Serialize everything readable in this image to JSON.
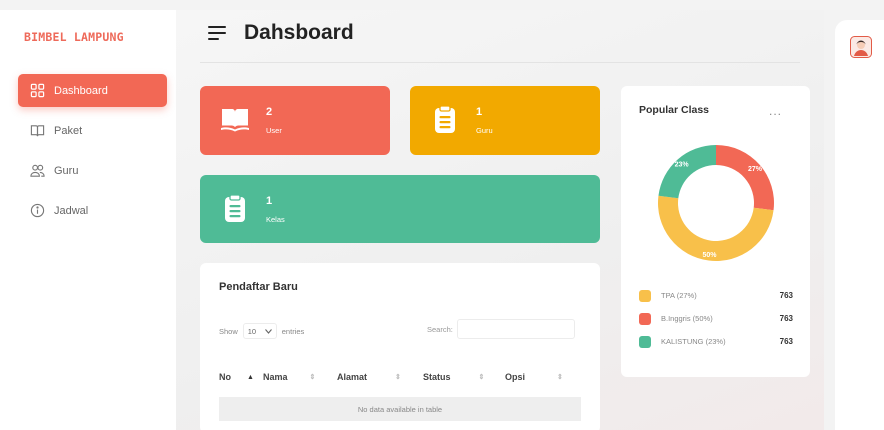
{
  "brand": "BIMBEL LAMPUNG",
  "sidebar": {
    "items": [
      {
        "label": "Dashboard",
        "icon": "grid-icon"
      },
      {
        "label": "Paket",
        "icon": "book-icon"
      },
      {
        "label": "Guru",
        "icon": "users-icon"
      },
      {
        "label": "Jadwal",
        "icon": "info-icon"
      }
    ]
  },
  "header": {
    "title": "Dahsboard"
  },
  "cards": {
    "user": {
      "value": "2",
      "label": "User",
      "color": "#f26855"
    },
    "guru": {
      "value": "1",
      "label": "Guru",
      "color": "#f2a900"
    },
    "kelas": {
      "value": "1",
      "label": "Kelas",
      "color": "#4fbb96"
    }
  },
  "table": {
    "title": "Pendaftar Baru",
    "show_label": "Show",
    "entries_value": "10",
    "entries_label": "entries",
    "search_label": "Search:",
    "search_value": "",
    "columns": [
      "No",
      "Nama",
      "Alamat",
      "Status",
      "Opsi"
    ],
    "empty_text": "No data available in table"
  },
  "popular": {
    "title": "Popular Class",
    "menu": "..."
  },
  "chart_data": {
    "type": "pie",
    "slices": [
      {
        "label": "TPA (27%)",
        "percent": 27,
        "display": "27%",
        "value": "763",
        "color": "#f26855"
      },
      {
        "label": "B.Inggris (50%)",
        "percent": 50,
        "display": "50%",
        "value": "763",
        "color": "#f8c04a"
      },
      {
        "label": "KALISTUNG (23%)",
        "percent": 23,
        "display": "23%",
        "value": "763",
        "color": "#4fbb96"
      }
    ]
  },
  "legend": [
    {
      "label": "TPA (27%)",
      "value": "763",
      "color": "#f8c04a"
    },
    {
      "label": "B.Inggris (50%)",
      "value": "763",
      "color": "#f26855"
    },
    {
      "label": "KALISTUNG (23%)",
      "value": "763",
      "color": "#4fbb96"
    }
  ]
}
